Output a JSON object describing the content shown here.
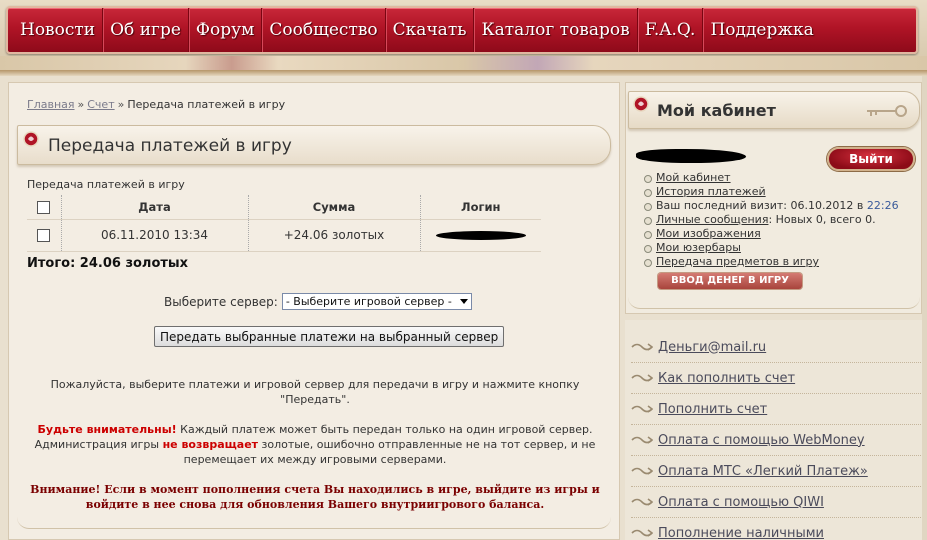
{
  "nav": {
    "items": [
      "Новости",
      "Об игре",
      "Форум",
      "Сообщество",
      "Скачать",
      "Каталог товаров",
      "F.A.Q.",
      "Поддержка"
    ]
  },
  "breadcrumb": {
    "home": "Главная",
    "account": "Счет",
    "sep": "»",
    "current": "Передача платежей в игру"
  },
  "page": {
    "title": "Передача платежей в игру",
    "caption": "Передача платежей в игру"
  },
  "table": {
    "headers": [
      "Дата",
      "Сумма",
      "Логин"
    ],
    "rows": [
      {
        "date": "06.11.2010 13:34",
        "amount": "+24.06 золотых"
      }
    ],
    "total": "Итого: 24.06 золотых"
  },
  "server": {
    "label": "Выберите сервер:",
    "selected": "- Выберите игровой сервер -"
  },
  "transfer_button": "Передать выбранные платежи на выбранный сервер",
  "info": {
    "instruction": "Пожалуйста, выберите платежи и игровой сервер для передачи в игру и нажмите кнопку \"Передать\".",
    "warning_lead": "Будьте внимательны!",
    "warning_text_1": " Каждый платеж может быть передан только на один игровой сервер. Администрация игры ",
    "warning_emph": "не возвращает",
    "warning_text_2": " золотые, ошибочно отправленные не на тот сервер, и не перемещает их между игровыми серверами.",
    "notice": "Внимание! Если в момент пополнения счета Вы находились в игре, выйдите из игры и войдите в нее снова для обновления Вашего внутриигрового баланса."
  },
  "cabinet": {
    "title": "Мой кабинет",
    "logout": "Выйти",
    "links": {
      "my_cabinet": "Мой кабинет",
      "payment_history": "История платежей",
      "last_visit_label": "Ваш последний визит: 06.10.2012 в ",
      "last_visit_time": "22:26",
      "messages": "Личные сообщения",
      "messages_counts": ": Новых 0, всего 0.",
      "images": "Мои изображения",
      "userbars": "Мои юзербары",
      "items_transfer": "Передача предметов  в игру"
    },
    "deposit_button": "ВВОД ДЕНЕГ В ИГРУ"
  },
  "payment_links": [
    "Деньги@mail.ru",
    "Как пополнить счет",
    "Пополнить счет",
    "Оплата с помощью WebMoney",
    "Оплата МТС «Легкий Платеж»",
    "Оплата с помощью QIWI",
    "Пополнение наличными"
  ],
  "colors": {
    "nav_red": "#b01426",
    "warning_red": "#cc0000",
    "notice_dark_red": "#7a0000",
    "time_blue": "#3a5a9a"
  }
}
